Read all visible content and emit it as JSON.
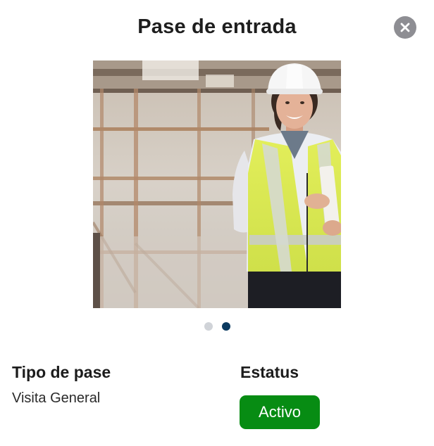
{
  "header": {
    "title": "Pase de entrada",
    "close_icon": "close-circle-icon"
  },
  "photo": {
    "alt": "Trabajadora de construcción con casco y chaleco reflectante"
  },
  "carousel": {
    "total_pages": 2,
    "current_page": 2
  },
  "details": {
    "type_label": "Tipo de pase",
    "type_value": "Visita General",
    "status_label": "Estatus",
    "status_value": "Activo"
  },
  "colors": {
    "status_active": "#078c13",
    "dot_active": "#0b3a60",
    "dot_inactive": "#d0d3d8",
    "close_button": "#8e8e93"
  }
}
